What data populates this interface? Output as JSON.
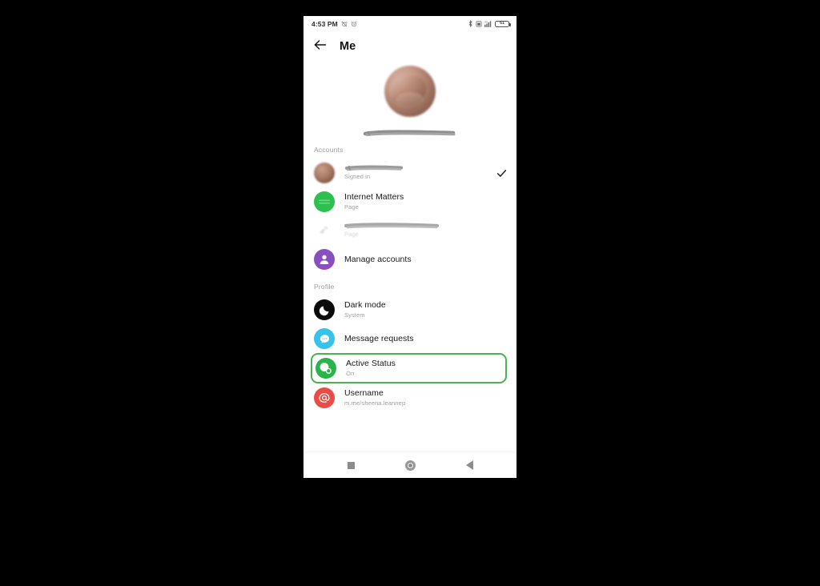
{
  "status_bar": {
    "time": "4:53 PM",
    "left_icons": [
      "alarm-muted-icon",
      "clock-icon"
    ],
    "right_icons": [
      "bluetooth-icon",
      "sim-icon",
      "signal-icon"
    ],
    "battery_level": "61"
  },
  "app_bar": {
    "back_icon": "back-arrow-icon",
    "title": "Me"
  },
  "profile_header": {
    "photo": "profile-photo",
    "name_redacted": true
  },
  "sections": [
    {
      "label": "Accounts",
      "rows": [
        {
          "avatar": "avatar-photo-blur",
          "title": "",
          "title_redacted": true,
          "subtitle": "Signed in",
          "trailing": "check-icon"
        },
        {
          "avatar": "avatar-green",
          "title": "Internet Matters",
          "title_redacted": false,
          "subtitle": "Page",
          "trailing": ""
        },
        {
          "avatar": "avatar-faded",
          "title": "",
          "title_redacted": true,
          "subtitle": "Page",
          "trailing": ""
        },
        {
          "avatar": "avatar-purple",
          "title": "Manage accounts",
          "title_redacted": false,
          "subtitle": "",
          "trailing": ""
        }
      ]
    },
    {
      "label": "Profile",
      "rows": [
        {
          "avatar": "avatar-black",
          "title": "Dark mode",
          "title_redacted": false,
          "subtitle": "System",
          "trailing": ""
        },
        {
          "avatar": "avatar-cyan",
          "title": "Message requests",
          "title_redacted": false,
          "subtitle": "",
          "trailing": ""
        },
        {
          "avatar": "avatar-green2",
          "title": "Active Status",
          "title_redacted": false,
          "subtitle": "On",
          "trailing": "",
          "highlighted": true
        },
        {
          "avatar": "avatar-red",
          "title": "Username",
          "title_redacted": false,
          "subtitle": "m.me/sheena.leannep",
          "trailing": ""
        }
      ]
    }
  ],
  "nav_bar": {
    "recents_label": "recents-square-icon",
    "home_label": "home-circle-icon",
    "back_label": "back-triangle-icon"
  },
  "colors": {
    "highlight_border": "#4cb150",
    "page_background": "#000000",
    "screen_background": "#ffffff",
    "green_avatar": "#2ec04e",
    "purple_avatar": "#8a4fbf",
    "cyan_avatar": "#37c2ec",
    "red_avatar": "#ec4a45",
    "active_status_avatar": "#28b44a"
  }
}
